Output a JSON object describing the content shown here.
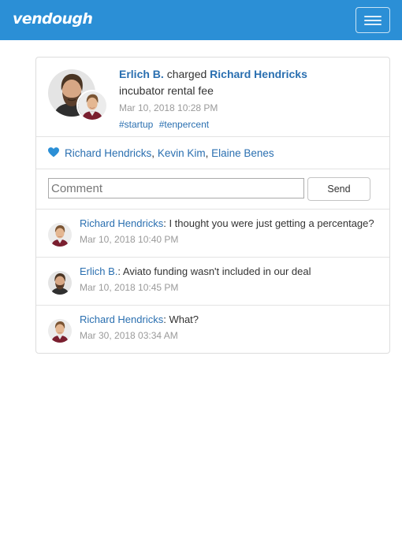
{
  "app": {
    "brand": "vendough",
    "accent": "#2b8fd6"
  },
  "navbar": {
    "menu_icon": "hamburger-icon"
  },
  "transaction": {
    "actor": "Erlich B.",
    "action": "charged",
    "target": "Richard Hendricks",
    "description": "incubator rental fee",
    "date": "Mar 10, 2018 10:28 PM",
    "tags": [
      "#startup",
      "#tenpercent"
    ]
  },
  "likes": {
    "icon": "heart-icon",
    "users": [
      "Richard Hendricks",
      "Kevin Kim",
      "Elaine Benes"
    ],
    "separator": ", "
  },
  "comment_form": {
    "placeholder": "Comment",
    "value": "",
    "send_label": "Send"
  },
  "comments": [
    {
      "author": "Richard Hendricks",
      "separator": ":",
      "text": " I thought you were just getting a percentage?",
      "date": "Mar 10, 2018 10:40 PM"
    },
    {
      "author": "Erlich B.",
      "separator": ":",
      "text": " Aviato funding wasn't included in our deal",
      "date": "Mar 10, 2018 10:45 PM"
    },
    {
      "author": "Richard Hendricks",
      "separator": ":",
      "text": " What?",
      "date": "Mar 30, 2018 03:34 AM"
    }
  ]
}
